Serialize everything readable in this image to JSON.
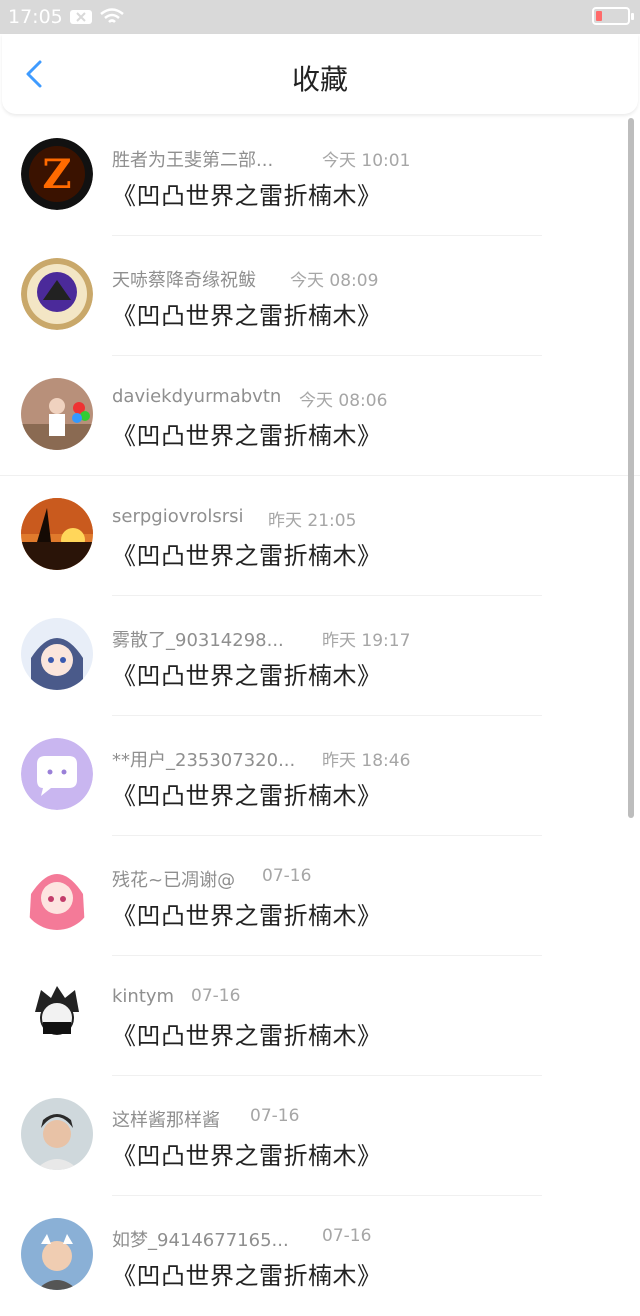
{
  "status_bar": {
    "time": "17:05"
  },
  "header": {
    "title": "收藏"
  },
  "items": [
    {
      "name": "胜者为王斐第二部...",
      "time": "今天 10:01",
      "content": "《凹凸世界之雷折楠木》"
    },
    {
      "name": "天哧蔡降奇缘祝鲅",
      "time": "今天 08:09",
      "content": "《凹凸世界之雷折楠木》"
    },
    {
      "name": "daviekdyurmabvtn",
      "time": "今天 08:06",
      "content": "《凹凸世界之雷折楠木》"
    },
    {
      "name": "serpgiovrolsrsi",
      "time": "昨天 21:05",
      "content": "《凹凸世界之雷折楠木》"
    },
    {
      "name": "雾散了_90314298...",
      "time": "昨天 19:17",
      "content": "《凹凸世界之雷折楠木》"
    },
    {
      "name": "**用户_235307320...",
      "time": "昨天 18:46",
      "content": "《凹凸世界之雷折楠木》"
    },
    {
      "name": "残花~已凋谢@",
      "time": "07-16",
      "content": "《凹凸世界之雷折楠木》"
    },
    {
      "name": "kintym",
      "time": "07-16",
      "content": "《凹凸世界之雷折楠木》"
    },
    {
      "name": "这样酱那样酱",
      "time": "07-16",
      "content": "《凹凸世界之雷折楠木》"
    },
    {
      "name": "如梦_9414677165...",
      "time": "07-16",
      "content": "《凹凸世界之雷折楠木》"
    }
  ],
  "colors": {
    "accent": "#3f9bff",
    "name_text": "#8f8f8f",
    "time_text": "#a6a6a6",
    "status_bar": "#d9d9d9"
  }
}
